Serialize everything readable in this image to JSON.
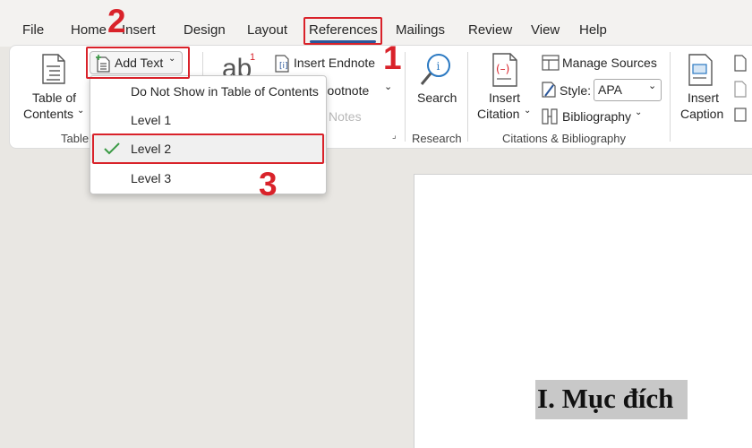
{
  "tabs": [
    "File",
    "Home",
    "Insert",
    "Design",
    "Layout",
    "References",
    "Mailings",
    "Review",
    "View",
    "Help"
  ],
  "active_tab": "References",
  "ribbon": {
    "toc": {
      "label_line1": "Table of",
      "label_line2": "Contents",
      "group_label": "Table"
    },
    "add_text": {
      "label": "Add Text"
    },
    "footnotes": {
      "insert_endnote": "Insert Endnote",
      "next_footnote": "Footnote",
      "show_notes": "Notes",
      "superscript": "1"
    },
    "research": {
      "search_label": "Search",
      "group_label": "Research"
    },
    "citations": {
      "insert_citation_line1": "Insert",
      "insert_citation_line2": "Citation",
      "manage_sources": "Manage Sources",
      "style_label": "Style:",
      "style_value": "APA",
      "bibliography": "Bibliography",
      "group_label": "Citations & Bibliography"
    },
    "captions": {
      "insert_caption_line1": "Insert",
      "insert_caption_line2": "Caption"
    }
  },
  "menu": {
    "items": [
      "Do Not Show in Table of Contents",
      "Level 1",
      "Level 2",
      "Level 3"
    ],
    "selected": "Level 2"
  },
  "document": {
    "heading": "I. Mục đích"
  },
  "annotations": {
    "step1": "1",
    "step2": "2",
    "step3": "3"
  },
  "colors": {
    "highlight": "#d9222a",
    "accent": "#2b579a",
    "check": "#3a9a45"
  }
}
